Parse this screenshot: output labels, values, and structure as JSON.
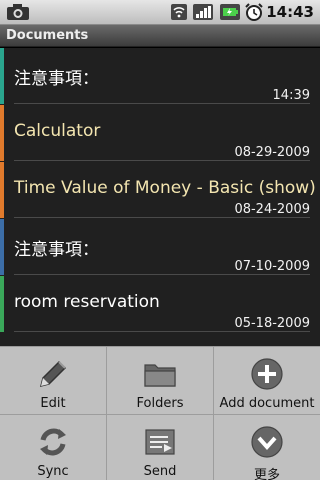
{
  "status_bar": {
    "time": "14:43"
  },
  "title_bar": {
    "title": "Documents"
  },
  "documents": [
    {
      "title": "注意事項：",
      "date": "14:39",
      "title_color": "#ffffff",
      "bar_color": "#2aa58e"
    },
    {
      "title": "Calculator",
      "date": "08-29-2009",
      "title_color": "#f3e5b0",
      "bar_color": "#e07a2c"
    },
    {
      "title": "Time Value of Money - Basic (show)",
      "date": "08-24-2009",
      "title_color": "#f3e5b0",
      "bar_color": "#e07a2c"
    },
    {
      "title": "注意事項：",
      "date": "07-10-2009",
      "title_color": "#ffffff",
      "bar_color": "#3c6ea8"
    },
    {
      "title": "room reservation",
      "date": "05-18-2009",
      "title_color": "#ffffff",
      "bar_color": "#3aa85a"
    }
  ],
  "options_menu": {
    "items": [
      {
        "label": "Edit",
        "icon": "pencil-icon"
      },
      {
        "label": "Folders",
        "icon": "folder-icon"
      },
      {
        "label": "Add document",
        "icon": "plus-circle-icon"
      },
      {
        "label": "Sync",
        "icon": "sync-icon"
      },
      {
        "label": "Send",
        "icon": "send-icon"
      },
      {
        "label": "更多",
        "icon": "more-icon"
      }
    ]
  }
}
